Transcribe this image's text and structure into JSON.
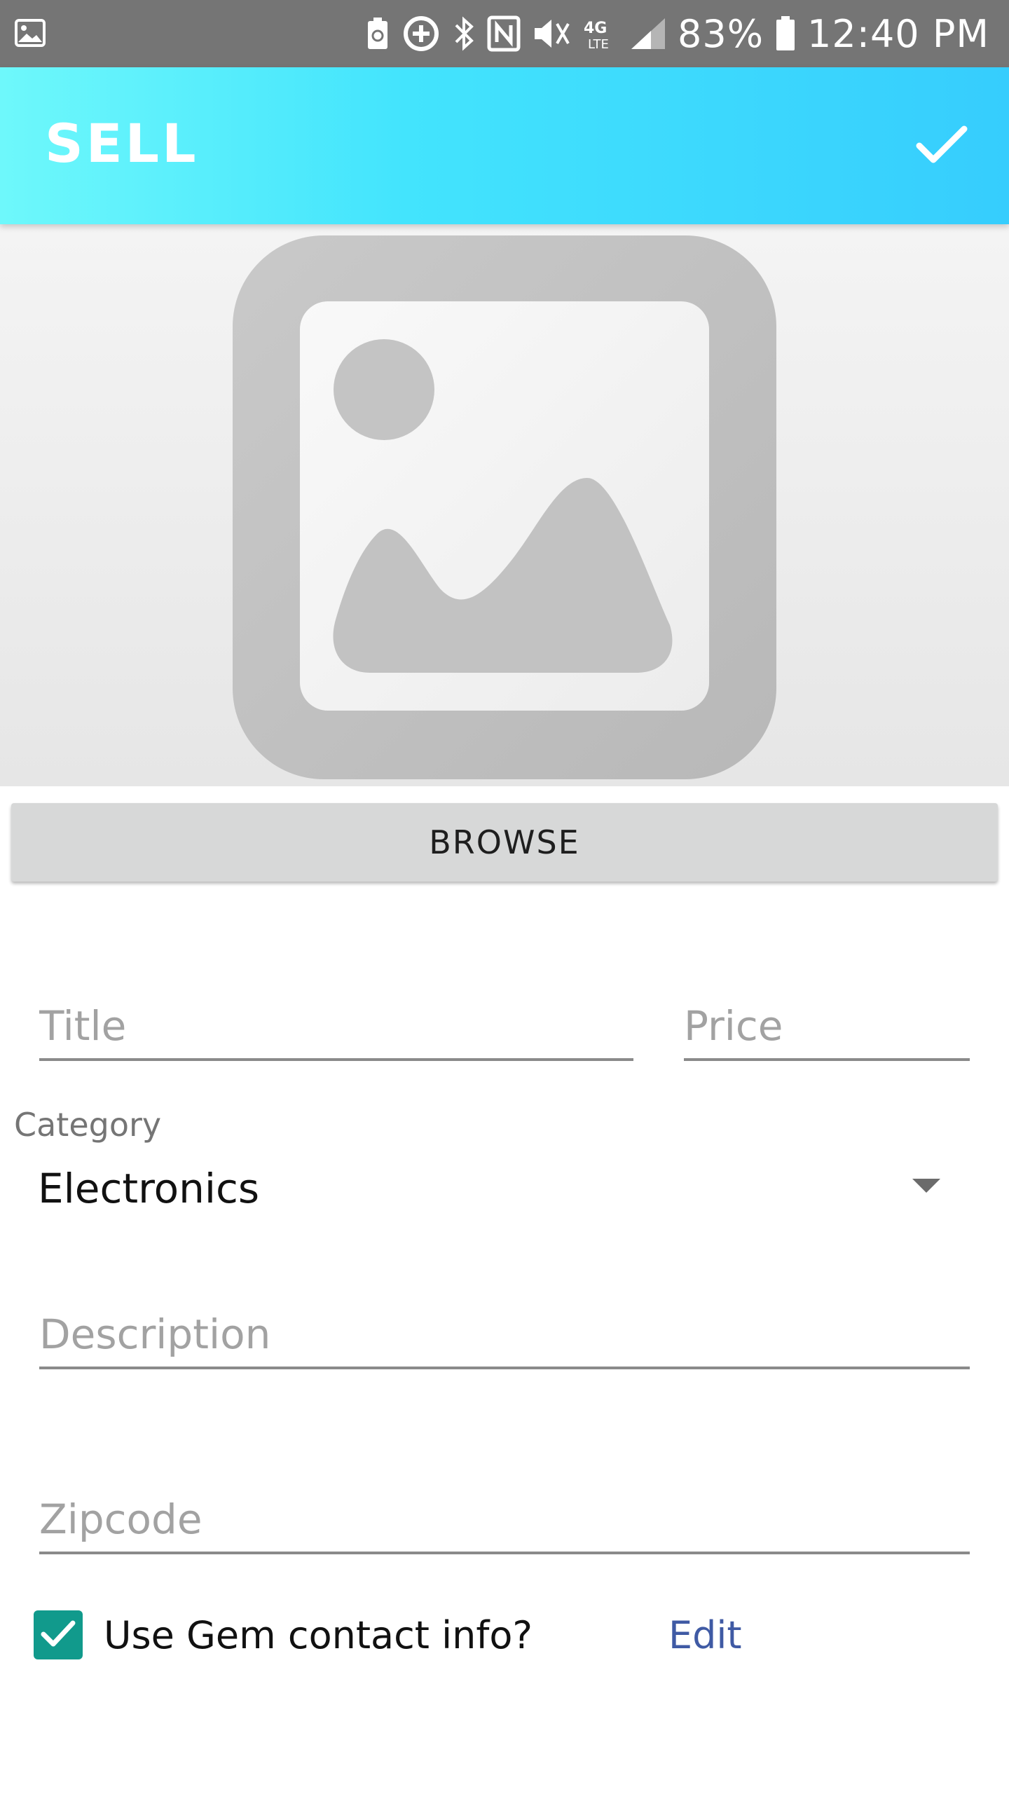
{
  "status_bar": {
    "battery": "83%",
    "time": "12:40 PM",
    "network": "4G LTE",
    "icons": [
      "gallery-icon",
      "battery-saver-icon",
      "data-saver-icon",
      "bluetooth-icon",
      "nfc-icon",
      "vibrate-icon",
      "lte-icon",
      "signal-icon",
      "battery-icon"
    ]
  },
  "app_bar": {
    "title": "SELL",
    "confirm_icon": "check-icon",
    "gradient_start": "#6ef8fb",
    "gradient_end": "#36cdfd"
  },
  "image_preview": {
    "icon": "image-placeholder-icon"
  },
  "browse": {
    "label": "BROWSE"
  },
  "form": {
    "title_placeholder": "Title",
    "price_placeholder": "Price",
    "category_label": "Category",
    "category_value": "Electronics",
    "description_placeholder": "Description",
    "zipcode_placeholder": "Zipcode"
  },
  "contact": {
    "checked": true,
    "label": "Use Gem contact info?",
    "edit_label": "Edit",
    "checkbox_color": "#119a8c",
    "link_color": "#3f5aa4"
  }
}
